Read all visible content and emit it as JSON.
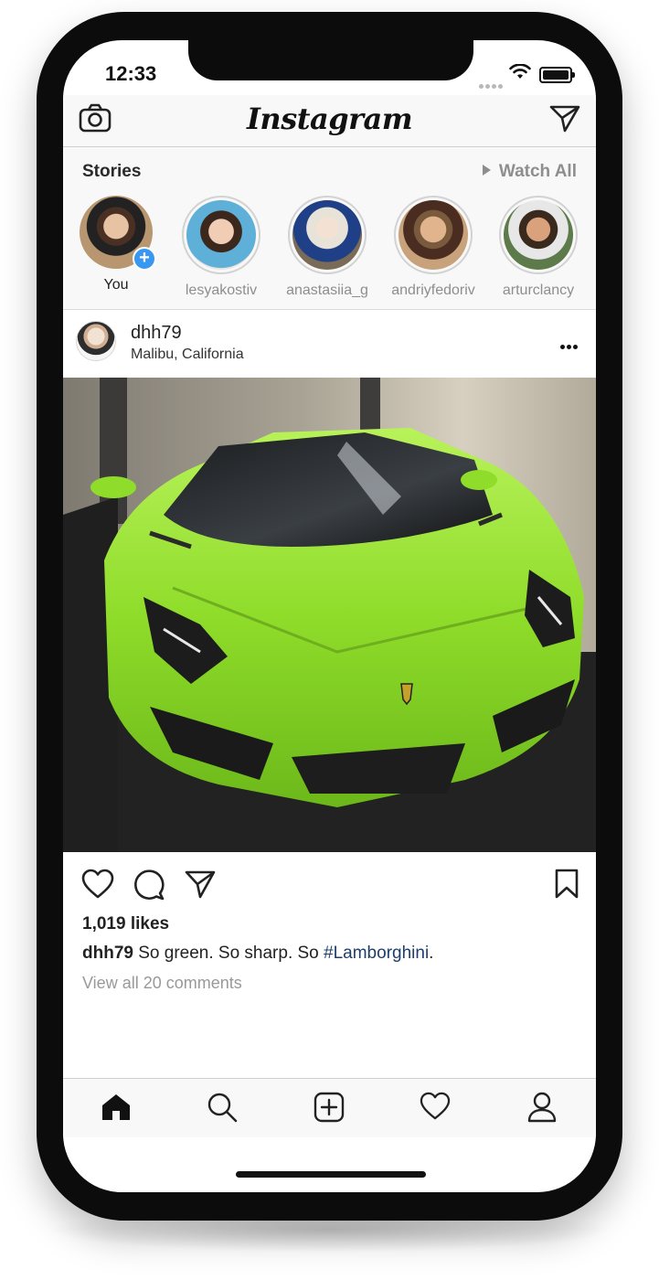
{
  "status": {
    "time": "12:33"
  },
  "header": {
    "brand": "Instagram"
  },
  "stories": {
    "title": "Stories",
    "watch_all": "Watch All",
    "items": [
      {
        "name": "You",
        "own": true
      },
      {
        "name": "lesyakostiv"
      },
      {
        "name": "anastasiia_g"
      },
      {
        "name": "andriyfedoriv"
      },
      {
        "name": "arturclancy"
      }
    ]
  },
  "post": {
    "username": "dhh79",
    "location": "Malibu, California",
    "likes": "1,019 likes",
    "caption_user": "dhh79",
    "caption_text": " So green. So sharp. So ",
    "caption_hashtag": "#Lamborghini",
    "caption_end": ".",
    "view_comments": "View all 20 comments"
  },
  "colors": {
    "accent": "#3897f0",
    "hashtag": "#1e3d6b",
    "car": "#8fdc2a"
  },
  "icons": {
    "topbar": [
      "camera-icon",
      "direct-message-icon"
    ],
    "post_actions": [
      "heart-icon",
      "comment-icon",
      "share-icon",
      "bookmark-icon"
    ],
    "tabs": [
      "home-icon",
      "search-icon",
      "add-post-icon",
      "activity-heart-icon",
      "profile-icon"
    ]
  }
}
